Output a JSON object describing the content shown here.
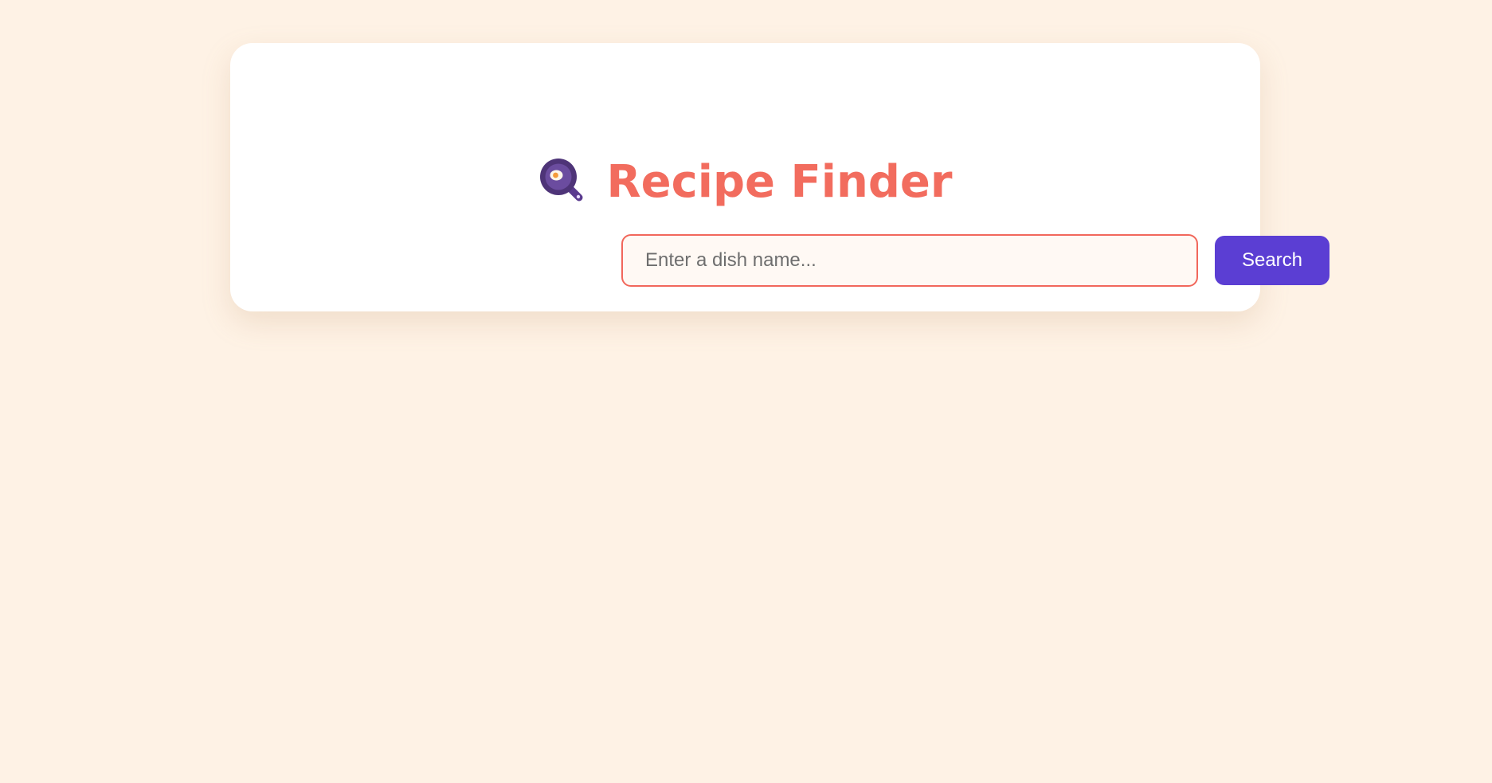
{
  "app": {
    "title": "Recipe Finder",
    "title_icon": "frying-pan-egg-icon",
    "colors": {
      "background": "#fef2e5",
      "card": "#ffffff",
      "title": "#f26c5e",
      "input_border": "#f1675b",
      "button": "#5b3ed3"
    }
  },
  "search": {
    "placeholder": "Enter a dish name...",
    "value": "",
    "button_label": "Search"
  }
}
